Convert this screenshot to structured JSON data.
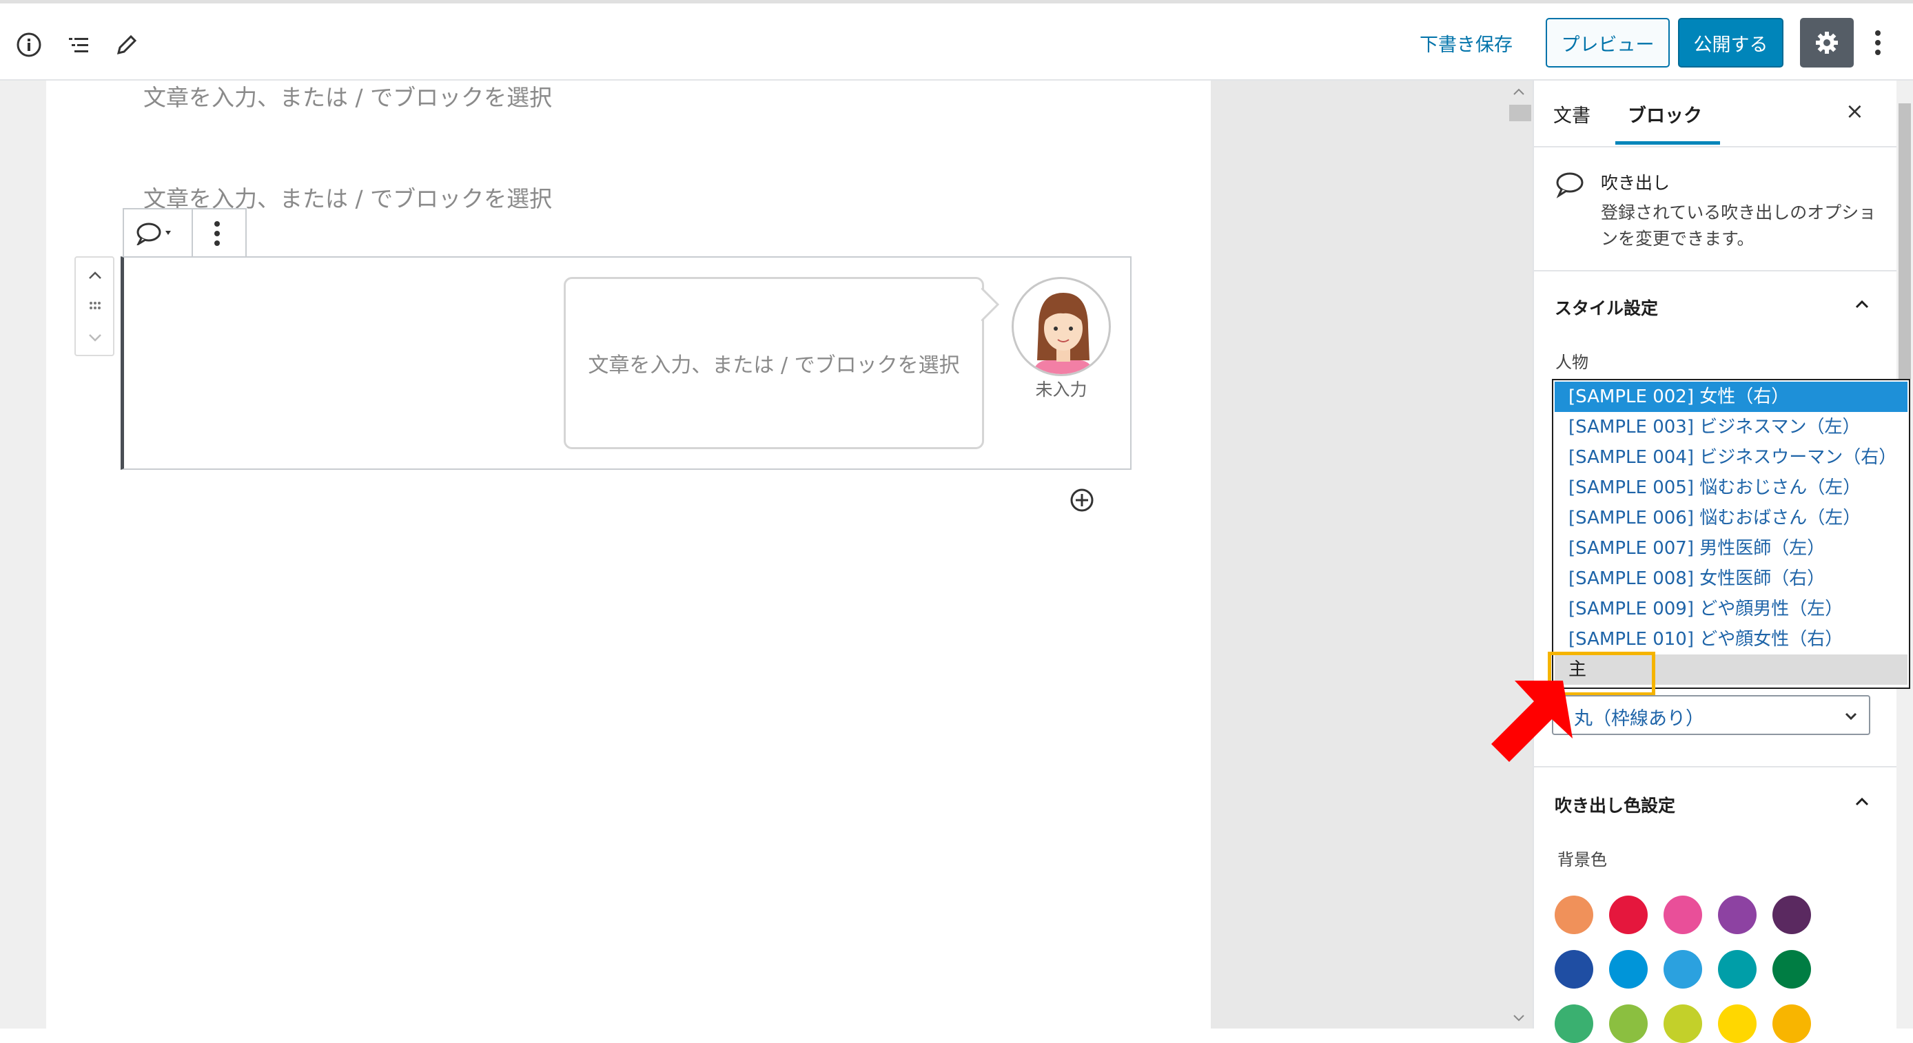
{
  "header": {
    "icons": [
      "info-icon",
      "list-view-icon",
      "pencil-icon"
    ],
    "save_draft_label": "下書き保存",
    "preview_label": "プレビュー",
    "publish_label": "公開する",
    "settings_icon": "gear-icon",
    "more_icon": "more-vertical-icon"
  },
  "editor": {
    "placeholder_1": "文章を入力、または / でブロックを選択",
    "placeholder_2": "文章を入力、または / でブロックを選択",
    "block_toolbar": {
      "block_icon": "speech-bubble-icon",
      "more_icon": "more-vertical-icon"
    },
    "balloon": {
      "placeholder": "文章を入力、または / でブロックを選択",
      "speaker_name": "未入力"
    }
  },
  "sidebar": {
    "tabs": [
      "文書",
      "ブロック"
    ],
    "active_tab": "ブロック",
    "close_label": "×",
    "block_card": {
      "name": "吹き出し",
      "description": "登録されている吹き出しのオプションを変更できます。"
    },
    "style_panel": {
      "title": "スタイル設定",
      "person_label": "人物",
      "options": [
        "[SAMPLE 002] 女性（右）",
        "[SAMPLE 003] ビジネスマン（左）",
        "[SAMPLE 004] ビジネスウーマン（右）",
        "[SAMPLE 005] 悩むおじさん（左）",
        "[SAMPLE 006] 悩むおばさん（左）",
        "[SAMPLE 007] 男性医師（左）",
        "[SAMPLE 008] 女性医師（右）",
        "[SAMPLE 009] どや顔男性（左）",
        "[SAMPLE 010] どや顔女性（右）",
        "主"
      ],
      "selected_option": "[SAMPLE 002] 女性（右）",
      "shape_value": "丸（枠線あり）"
    },
    "color_panel": {
      "title": "吹き出し色設定",
      "background_label": "背景色",
      "swatches": [
        "#f0915a",
        "#e5173d",
        "#e94f99",
        "#8d42a2",
        "#5a2960",
        "#1f4ea3",
        "#0095d9",
        "#2ba1df",
        "#009ea8",
        "#007d43",
        "#3ab070",
        "#8bbf40",
        "#c3d02a",
        "#ffd700",
        "#f8b500"
      ]
    }
  }
}
